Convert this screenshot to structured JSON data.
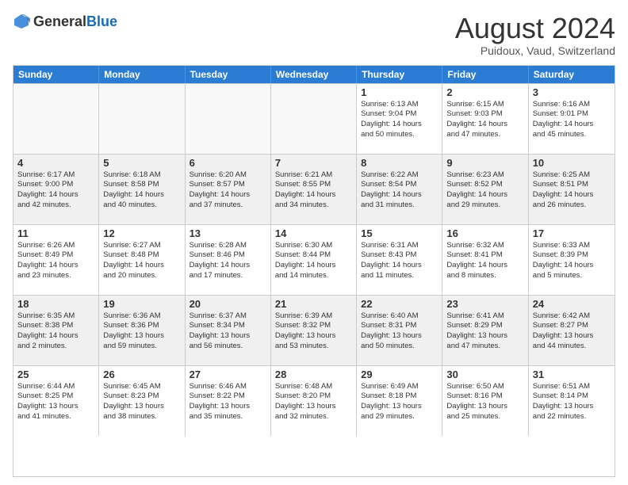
{
  "logo": {
    "general": "General",
    "blue": "Blue"
  },
  "title": "August 2024",
  "location": "Puidoux, Vaud, Switzerland",
  "days_of_week": [
    "Sunday",
    "Monday",
    "Tuesday",
    "Wednesday",
    "Thursday",
    "Friday",
    "Saturday"
  ],
  "weeks": [
    [
      {
        "day": "",
        "info": ""
      },
      {
        "day": "",
        "info": ""
      },
      {
        "day": "",
        "info": ""
      },
      {
        "day": "",
        "info": ""
      },
      {
        "day": "1",
        "info": "Sunrise: 6:13 AM\nSunset: 9:04 PM\nDaylight: 14 hours\nand 50 minutes."
      },
      {
        "day": "2",
        "info": "Sunrise: 6:15 AM\nSunset: 9:03 PM\nDaylight: 14 hours\nand 47 minutes."
      },
      {
        "day": "3",
        "info": "Sunrise: 6:16 AM\nSunset: 9:01 PM\nDaylight: 14 hours\nand 45 minutes."
      }
    ],
    [
      {
        "day": "4",
        "info": "Sunrise: 6:17 AM\nSunset: 9:00 PM\nDaylight: 14 hours\nand 42 minutes."
      },
      {
        "day": "5",
        "info": "Sunrise: 6:18 AM\nSunset: 8:58 PM\nDaylight: 14 hours\nand 40 minutes."
      },
      {
        "day": "6",
        "info": "Sunrise: 6:20 AM\nSunset: 8:57 PM\nDaylight: 14 hours\nand 37 minutes."
      },
      {
        "day": "7",
        "info": "Sunrise: 6:21 AM\nSunset: 8:55 PM\nDaylight: 14 hours\nand 34 minutes."
      },
      {
        "day": "8",
        "info": "Sunrise: 6:22 AM\nSunset: 8:54 PM\nDaylight: 14 hours\nand 31 minutes."
      },
      {
        "day": "9",
        "info": "Sunrise: 6:23 AM\nSunset: 8:52 PM\nDaylight: 14 hours\nand 29 minutes."
      },
      {
        "day": "10",
        "info": "Sunrise: 6:25 AM\nSunset: 8:51 PM\nDaylight: 14 hours\nand 26 minutes."
      }
    ],
    [
      {
        "day": "11",
        "info": "Sunrise: 6:26 AM\nSunset: 8:49 PM\nDaylight: 14 hours\nand 23 minutes."
      },
      {
        "day": "12",
        "info": "Sunrise: 6:27 AM\nSunset: 8:48 PM\nDaylight: 14 hours\nand 20 minutes."
      },
      {
        "day": "13",
        "info": "Sunrise: 6:28 AM\nSunset: 8:46 PM\nDaylight: 14 hours\nand 17 minutes."
      },
      {
        "day": "14",
        "info": "Sunrise: 6:30 AM\nSunset: 8:44 PM\nDaylight: 14 hours\nand 14 minutes."
      },
      {
        "day": "15",
        "info": "Sunrise: 6:31 AM\nSunset: 8:43 PM\nDaylight: 14 hours\nand 11 minutes."
      },
      {
        "day": "16",
        "info": "Sunrise: 6:32 AM\nSunset: 8:41 PM\nDaylight: 14 hours\nand 8 minutes."
      },
      {
        "day": "17",
        "info": "Sunrise: 6:33 AM\nSunset: 8:39 PM\nDaylight: 14 hours\nand 5 minutes."
      }
    ],
    [
      {
        "day": "18",
        "info": "Sunrise: 6:35 AM\nSunset: 8:38 PM\nDaylight: 14 hours\nand 2 minutes."
      },
      {
        "day": "19",
        "info": "Sunrise: 6:36 AM\nSunset: 8:36 PM\nDaylight: 13 hours\nand 59 minutes."
      },
      {
        "day": "20",
        "info": "Sunrise: 6:37 AM\nSunset: 8:34 PM\nDaylight: 13 hours\nand 56 minutes."
      },
      {
        "day": "21",
        "info": "Sunrise: 6:39 AM\nSunset: 8:32 PM\nDaylight: 13 hours\nand 53 minutes."
      },
      {
        "day": "22",
        "info": "Sunrise: 6:40 AM\nSunset: 8:31 PM\nDaylight: 13 hours\nand 50 minutes."
      },
      {
        "day": "23",
        "info": "Sunrise: 6:41 AM\nSunset: 8:29 PM\nDaylight: 13 hours\nand 47 minutes."
      },
      {
        "day": "24",
        "info": "Sunrise: 6:42 AM\nSunset: 8:27 PM\nDaylight: 13 hours\nand 44 minutes."
      }
    ],
    [
      {
        "day": "25",
        "info": "Sunrise: 6:44 AM\nSunset: 8:25 PM\nDaylight: 13 hours\nand 41 minutes."
      },
      {
        "day": "26",
        "info": "Sunrise: 6:45 AM\nSunset: 8:23 PM\nDaylight: 13 hours\nand 38 minutes."
      },
      {
        "day": "27",
        "info": "Sunrise: 6:46 AM\nSunset: 8:22 PM\nDaylight: 13 hours\nand 35 minutes."
      },
      {
        "day": "28",
        "info": "Sunrise: 6:48 AM\nSunset: 8:20 PM\nDaylight: 13 hours\nand 32 minutes."
      },
      {
        "day": "29",
        "info": "Sunrise: 6:49 AM\nSunset: 8:18 PM\nDaylight: 13 hours\nand 29 minutes."
      },
      {
        "day": "30",
        "info": "Sunrise: 6:50 AM\nSunset: 8:16 PM\nDaylight: 13 hours\nand 25 minutes."
      },
      {
        "day": "31",
        "info": "Sunrise: 6:51 AM\nSunset: 8:14 PM\nDaylight: 13 hours\nand 22 minutes."
      }
    ]
  ]
}
